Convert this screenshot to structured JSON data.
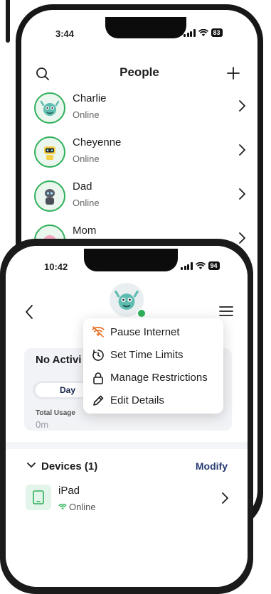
{
  "back_phone": {
    "time": "3:44",
    "battery": "83",
    "title": "People",
    "people": [
      {
        "name": "Charlie",
        "status": "Online"
      },
      {
        "name": "Cheyenne",
        "status": "Online"
      },
      {
        "name": "Dad",
        "status": "Online"
      },
      {
        "name": "Mom",
        "status": ""
      }
    ]
  },
  "front_phone": {
    "time": "10:42",
    "battery": "94",
    "activity": {
      "title": "No Activi",
      "segment_day": "Day",
      "total_usage_label": "Total Usage",
      "total_usage_value": "0m"
    },
    "devices": {
      "title": "Devices (1)",
      "modify": "Modify",
      "items": [
        {
          "name": "iPad",
          "status": "Online"
        }
      ]
    },
    "menu": {
      "items": [
        {
          "label": "Pause Internet",
          "icon": "wifi-off-icon",
          "color": "#e8702a"
        },
        {
          "label": "Set Time Limits",
          "icon": "timer-icon"
        },
        {
          "label": "Manage Restrictions",
          "icon": "lock-icon"
        },
        {
          "label": "Edit Details",
          "icon": "pencil-icon"
        }
      ]
    }
  },
  "colors": {
    "online": "#2fb05a",
    "accent": "#263a72",
    "pause": "#e8702a"
  }
}
